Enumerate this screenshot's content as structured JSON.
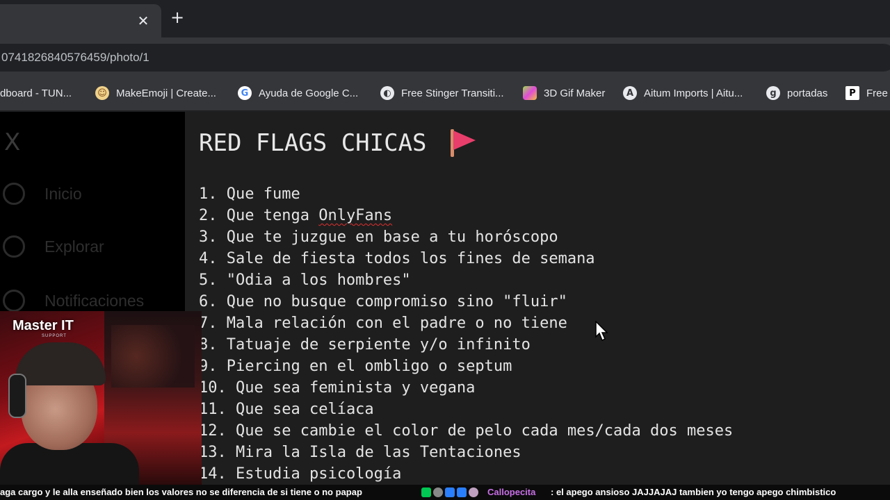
{
  "browser": {
    "tab_close_icon": "close-icon",
    "new_tab_icon": "plus-icon",
    "url": "0741826840576459/photo/1",
    "bookmarks": [
      {
        "label": "dboard - TUN...",
        "icon": "none"
      },
      {
        "label": "MakeEmoji | Create...",
        "icon": "emoji-icon"
      },
      {
        "label": "Ayuda de Google C...",
        "icon": "google-icon"
      },
      {
        "label": "Free Stinger Transiti...",
        "icon": "stinger-icon"
      },
      {
        "label": "3D Gif Maker",
        "icon": "gif-maker-icon"
      },
      {
        "label": "Aitum Imports | Aitu...",
        "icon": "aitum-icon"
      },
      {
        "label": "portadas",
        "icon": "portadas-icon"
      },
      {
        "label": "Free",
        "icon": "p-icon"
      }
    ]
  },
  "sidebar": {
    "logo": "X",
    "items": [
      {
        "label": "Inicio",
        "icon": "home-icon"
      },
      {
        "label": "Explorar",
        "icon": "search-icon"
      },
      {
        "label": "Notificaciones",
        "icon": "bell-icon"
      }
    ]
  },
  "note": {
    "title": "RED FLAGS CHICAS",
    "title_icon": "red-flag-icon",
    "items": [
      {
        "num": "1.",
        "text": "Que fume"
      },
      {
        "num": "2.",
        "text_before": "Que tenga ",
        "misspelled": "OnlyFans"
      },
      {
        "num": "3.",
        "text": "Que te juzgue en base a tu horóscopo"
      },
      {
        "num": "4.",
        "text": "Sale de fiesta todos los fines de semana"
      },
      {
        "num": "5.",
        "text": "\"Odia a los hombres\""
      },
      {
        "num": "6.",
        "text": "Que no busque compromiso sino \"fluir\""
      },
      {
        "num": "7.",
        "text": "Mala relación con el padre o no tiene"
      },
      {
        "num": "8.",
        "text": "Tatuaje de serpiente y/o infinito"
      },
      {
        "num": "9.",
        "text": "Piercing en el ombligo o septum"
      },
      {
        "num": "10.",
        "text": "Que sea feminista y vegana"
      },
      {
        "num": "11.",
        "text": "Que sea celíaca"
      },
      {
        "num": "12.",
        "text": "Que se cambie el color de pelo cada mes/cada dos meses"
      },
      {
        "num": "13.",
        "text": "Mira la Isla de las Tentaciones"
      },
      {
        "num": "14.",
        "text": "Estudia psicología"
      }
    ]
  },
  "webcam": {
    "brand": "Master IT",
    "brand_sub": "SUPPORT"
  },
  "chat": {
    "left_message": "aga cargo y le alla enseñado bien los valores no se diferencia de si tiene o no papap",
    "username": "Callopecita",
    "message": ":  el apego ansioso  JAJJAJAJ  tambien  yo tengo apego chimbistico",
    "username_color": "#c86fe6"
  }
}
